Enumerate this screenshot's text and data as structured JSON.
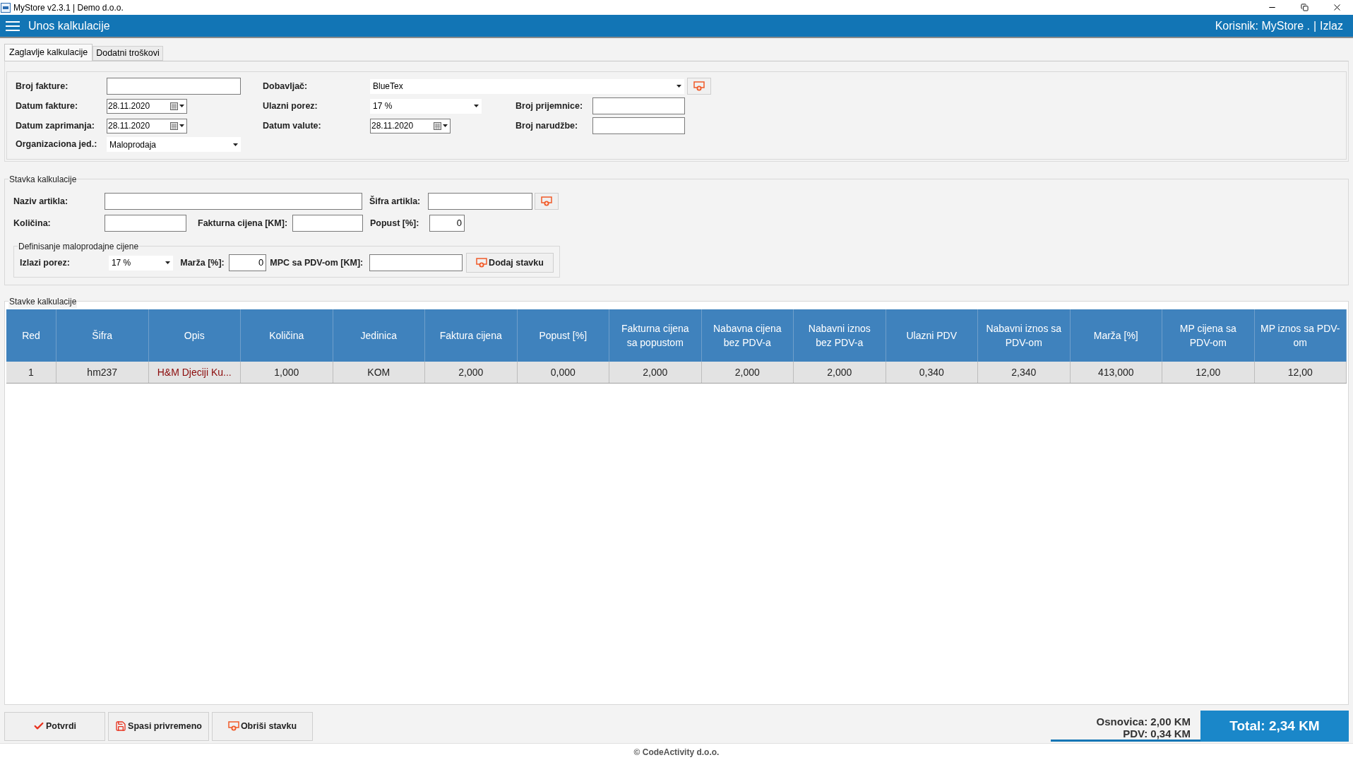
{
  "window": {
    "title": "MyStore v2.3.1 | Demo d.o.o."
  },
  "header": {
    "title": "Unos kalkulacije",
    "user": "Korisnik: MyStore .",
    "separator": "|",
    "logout": "Izlaz"
  },
  "tabs": [
    {
      "label": "Zaglavlje kalkulacije",
      "selected": true
    },
    {
      "label": "Dodatni troškovi",
      "selected": false
    }
  ],
  "invoice_header": {
    "invoice_number": {
      "label": "Broj fakture:"
    },
    "supplier": {
      "label": "Dobavljač:",
      "value": "BlueTex"
    },
    "invoice_date": {
      "label": "Datum fakture:",
      "value": "28.11.2020"
    },
    "input_tax": {
      "label": "Ulazni porez:",
      "value": "17 %"
    },
    "receipt_number": {
      "label": "Broj prijemnice:"
    },
    "receipt_date": {
      "label": "Datum zaprimanja:",
      "value": "28.11.2020"
    },
    "value_date": {
      "label": "Datum valute:",
      "value": "28.11.2020"
    },
    "order_number": {
      "label": "Broj narudžbe:"
    },
    "org_unit": {
      "label": "Organizaciona jed.:",
      "value": "Maloprodaja"
    }
  },
  "item": {
    "title": "Stavka kalkulacije",
    "article_name": {
      "label": "Naziv artikla:"
    },
    "article_code": {
      "label": "Šifra artikla:"
    },
    "quantity": {
      "label": "Količina:"
    },
    "invoice_price": {
      "label": "Fakturna cijena [KM]:"
    },
    "discount": {
      "label": "Popust [%]:",
      "value": "0"
    },
    "retail": {
      "title": "Definisanje maloprodajne cijene",
      "output_tax": {
        "label": "Izlazi porez:",
        "value": "17 %"
      },
      "margin": {
        "label": "Marža [%]:",
        "value": "0"
      },
      "retail_price": {
        "label": "MPC sa PDV-om [KM]:"
      },
      "add_button": "Dodaj stavku"
    }
  },
  "table": {
    "title": "Stavke kalkulacije",
    "columns": [
      "Red",
      "Šifra",
      "Opis",
      "Količina",
      "Jedinica",
      "Faktura cijena",
      "Popust [%]",
      "Fakturna cijena sa popustom",
      "Nabavna cijena bez PDV-a",
      "Nabavni iznos bez PDV-a",
      "Ulazni PDV",
      "Nabavni iznos sa PDV-om",
      "Marža [%]",
      "MP cijena sa PDV-om",
      "MP iznos sa PDV-om"
    ],
    "rows": [
      {
        "selected": true,
        "cells": [
          "1",
          "hm237",
          "H&M Djeciji Ku...",
          "1,000",
          "KOM",
          "2,000",
          "0,000",
          "2,000",
          "2,000",
          "2,000",
          "0,340",
          "2,340",
          "413,000",
          "12,00",
          "12,00"
        ]
      }
    ]
  },
  "buttons": [
    {
      "kind": "confirm",
      "label": "Potvrdi"
    },
    {
      "kind": "save",
      "label": "Spasi privremeno"
    },
    {
      "kind": "delete",
      "label": "Obriši stavku"
    }
  ],
  "totals": {
    "base": "Osnovica: 2,00 KM",
    "vat": "PDV: 0,34 KM",
    "total": "Total: 2,34 KM"
  },
  "footer": "© CodeActivity d.o.o."
}
